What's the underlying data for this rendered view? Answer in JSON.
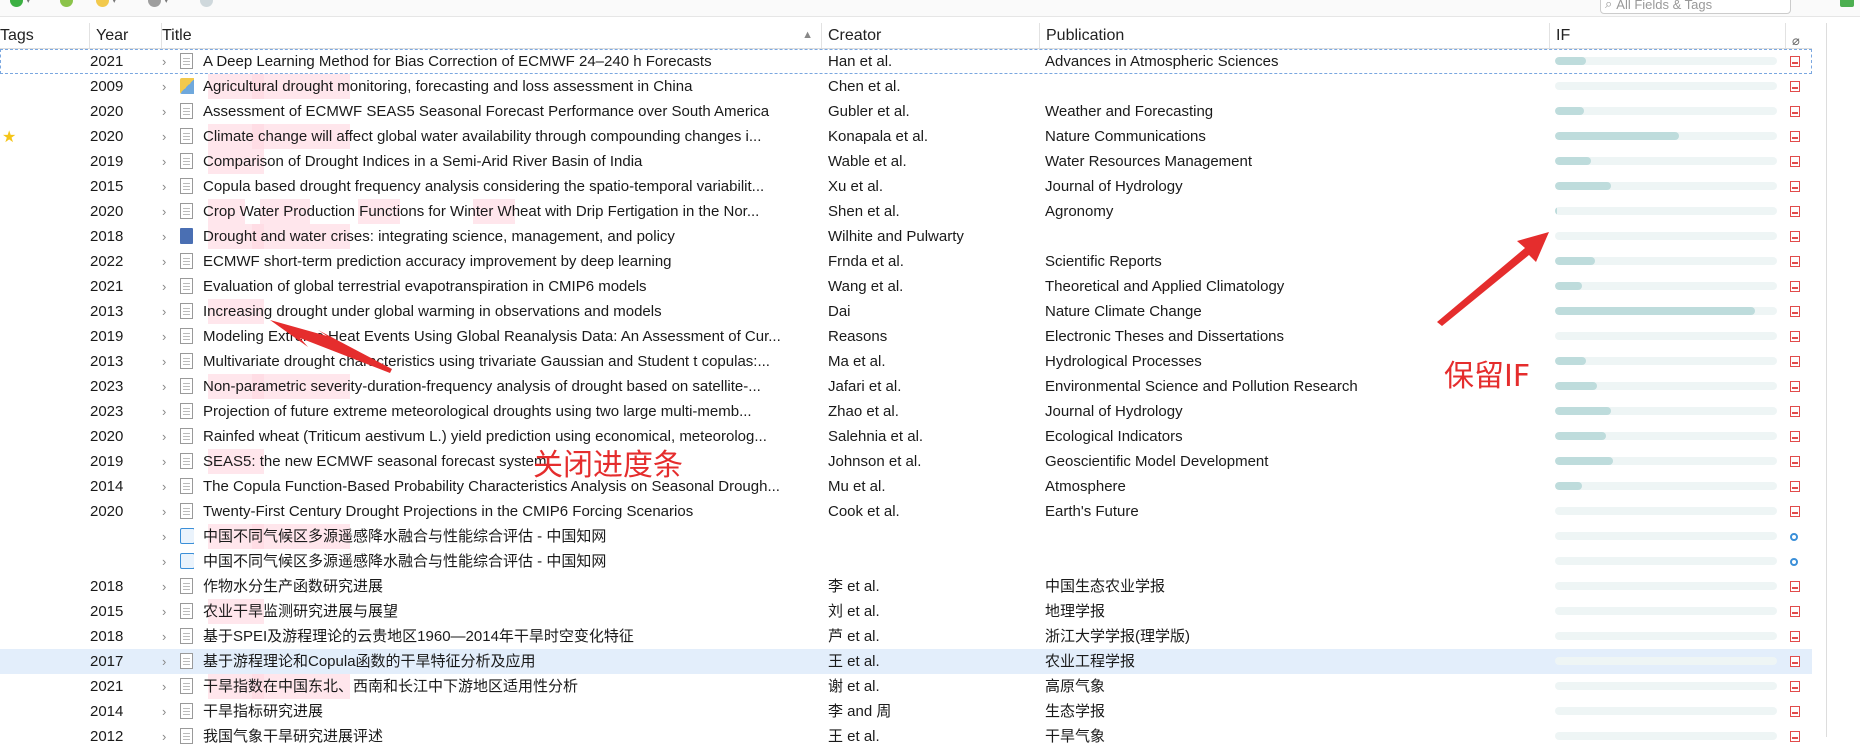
{
  "toolbar": {
    "search_placeholder": "All Fields & Tags"
  },
  "columns": {
    "tags": "Tags",
    "year": "Year",
    "title": "Title",
    "creator": "Creator",
    "publication": "Publication",
    "if": "IF"
  },
  "annotations": {
    "close_progress": "关闭进度条",
    "keep_if": "保留IF"
  },
  "rows": [
    {
      "year": "2021",
      "title": "A Deep Learning Method for Bias Correction of ECMWF 24–240 h Forecasts",
      "creator": "Han et al.",
      "publication": "Advances in Atmospheric Sciences",
      "if_fill": 0.14,
      "attachment": "pdf",
      "item_icon": "document-icon"
    },
    {
      "year": "2009",
      "title": "Agricultural drought monitoring, forecasting and loss assessment in China",
      "creator": "Chen et al.",
      "publication": "",
      "if_fill": 0,
      "attachment": "pdf",
      "item_icon": "map-icon"
    },
    {
      "year": "2020",
      "title": "Assessment of ECMWF SEAS5 Seasonal Forecast Performance over South America",
      "creator": "Gubler et al.",
      "publication": "Weather and Forecasting",
      "if_fill": 0.13,
      "attachment": "pdf",
      "item_icon": "document-icon"
    },
    {
      "year": "2020",
      "title": "Climate change will affect global water availability through compounding changes i...",
      "creator": "Konapala et al.",
      "publication": "Nature Communications",
      "if_fill": 0.56,
      "attachment": "pdf",
      "item_icon": "document-icon",
      "starred": true
    },
    {
      "year": "2019",
      "title": "Comparison of Drought Indices in a Semi-Arid River Basin of India",
      "creator": "Wable et al.",
      "publication": "Water Resources Management",
      "if_fill": 0.16,
      "attachment": "pdf",
      "item_icon": "document-icon"
    },
    {
      "year": "2015",
      "title": "Copula based drought frequency analysis considering the spatio-temporal variabilit...",
      "creator": "Xu et al.",
      "publication": "Journal of Hydrology",
      "if_fill": 0.25,
      "attachment": "pdf",
      "item_icon": "document-icon"
    },
    {
      "year": "2020",
      "title": "Crop Water Production Functions for Winter Wheat with Drip Fertigation in the Nor...",
      "creator": "Shen et al.",
      "publication": "Agronomy",
      "if_fill": 0.01,
      "attachment": "pdf",
      "item_icon": "document-icon"
    },
    {
      "year": "2018",
      "title": "Drought and water crises: integrating science, management, and policy",
      "creator": "Wilhite and Pulwarty",
      "publication": "",
      "if_fill": 0,
      "attachment": "pdf",
      "item_icon": "book-icon"
    },
    {
      "year": "2022",
      "title": "ECMWF short-term prediction accuracy improvement by deep learning",
      "creator": "Frnda et al.",
      "publication": "Scientific Reports",
      "if_fill": 0.18,
      "attachment": "pdf",
      "item_icon": "document-icon"
    },
    {
      "year": "2021",
      "title": "Evaluation of global terrestrial evapotranspiration in CMIP6 models",
      "creator": "Wang et al.",
      "publication": "Theoretical and Applied Climatology",
      "if_fill": 0.12,
      "attachment": "pdf",
      "item_icon": "document-icon"
    },
    {
      "year": "2013",
      "title": "Increasing drought under global warming in observations and models",
      "creator": "Dai",
      "publication": "Nature Climate Change",
      "if_fill": 0.9,
      "attachment": "pdf",
      "item_icon": "document-icon"
    },
    {
      "year": "2019",
      "title": "Modeling Extreme Heat Events Using Global Reanalysis Data: An Assessment of Cur...",
      "creator": "Reasons",
      "publication": "Electronic Theses and Dissertations",
      "if_fill": 0,
      "attachment": "pdf",
      "item_icon": "document-icon"
    },
    {
      "year": "2013",
      "title": "Multivariate drought characteristics using trivariate Gaussian and Student t copulas:...",
      "creator": "Ma et al.",
      "publication": "Hydrological Processes",
      "if_fill": 0.14,
      "attachment": "pdf",
      "item_icon": "document-icon"
    },
    {
      "year": "2023",
      "title": "Non-parametric severity-duration-frequency analysis of drought based on satellite-...",
      "creator": "Jafari et al.",
      "publication": "Environmental Science and Pollution Research",
      "if_fill": 0.19,
      "attachment": "pdf",
      "item_icon": "document-icon"
    },
    {
      "year": "2023",
      "title": "Projection of future extreme meteorological droughts using two large multi-memb...",
      "creator": "Zhao et al.",
      "publication": "Journal of Hydrology",
      "if_fill": 0.25,
      "attachment": "pdf",
      "item_icon": "document-icon"
    },
    {
      "year": "2020",
      "title": "Rainfed wheat (Triticum aestivum L.) yield prediction using economical, meteorolog...",
      "creator": "Salehnia et al.",
      "publication": "Ecological Indicators",
      "if_fill": 0.23,
      "attachment": "pdf",
      "item_icon": "document-icon"
    },
    {
      "year": "2019",
      "title": "SEAS5: the new ECMWF seasonal forecast system",
      "creator": "Johnson et al.",
      "publication": "Geoscientific Model Development",
      "if_fill": 0.26,
      "attachment": "pdf",
      "item_icon": "document-icon"
    },
    {
      "year": "2014",
      "title": "The Copula Function-Based Probability Characteristics Analysis on Seasonal Drough...",
      "creator": "Mu et al.",
      "publication": "Atmosphere",
      "if_fill": 0.12,
      "attachment": "pdf",
      "item_icon": "document-icon"
    },
    {
      "year": "2020",
      "title": "Twenty-First Century Drought Projections in the CMIP6 Forcing Scenarios",
      "creator": "Cook et al.",
      "publication": "Earth's Future",
      "if_fill": 0,
      "attachment": "pdf",
      "item_icon": "document-icon"
    },
    {
      "year": "",
      "title": "中国不同气候区多源遥感降水融合与性能综合评估 - 中国知网",
      "creator": "",
      "publication": "",
      "if_fill": 0,
      "attachment": "dot",
      "item_icon": "web-icon"
    },
    {
      "year": "",
      "title": "中国不同气候区多源遥感降水融合与性能综合评估 - 中国知网",
      "creator": "",
      "publication": "",
      "if_fill": 0,
      "attachment": "dot",
      "item_icon": "web-icon"
    },
    {
      "year": "2018",
      "title": "作物水分生产函数研究进展",
      "creator": "李 et al.",
      "publication": "中国生态农业学报",
      "if_fill": 0,
      "attachment": "pdf",
      "item_icon": "document-icon"
    },
    {
      "year": "2015",
      "title": "农业干旱监测研究进展与展望",
      "creator": "刘 et al.",
      "publication": "地理学报",
      "if_fill": 0,
      "attachment": "pdf",
      "item_icon": "document-icon"
    },
    {
      "year": "2018",
      "title": "基于SPEI及游程理论的云贵地区1960—2014年干旱时空变化特征",
      "creator": "芦 et al.",
      "publication": "浙江大学学报(理学版)",
      "if_fill": 0,
      "attachment": "pdf",
      "item_icon": "document-icon"
    },
    {
      "year": "2017",
      "title": "基于游程理论和Copula函数的干旱特征分析及应用",
      "creator": "王 et al.",
      "publication": "农业工程学报",
      "if_fill": 0,
      "attachment": "pdf",
      "item_icon": "document-icon",
      "selected": true
    },
    {
      "year": "2021",
      "title": "干旱指数在中国东北、西南和长江中下游地区适用性分析",
      "creator": "谢 et al.",
      "publication": "高原气象",
      "if_fill": 0,
      "attachment": "pdf",
      "item_icon": "document-icon"
    },
    {
      "year": "2014",
      "title": "干旱指标研究进展",
      "creator": "李 and 周",
      "publication": "生态学报",
      "if_fill": 0,
      "attachment": "pdf",
      "item_icon": "document-icon"
    },
    {
      "year": "2012",
      "title": "我国气象干旱研究进展评述",
      "creator": "王 et al.",
      "publication": "干旱气象",
      "if_fill": 0,
      "attachment": "pdf",
      "item_icon": "document-icon"
    }
  ]
}
